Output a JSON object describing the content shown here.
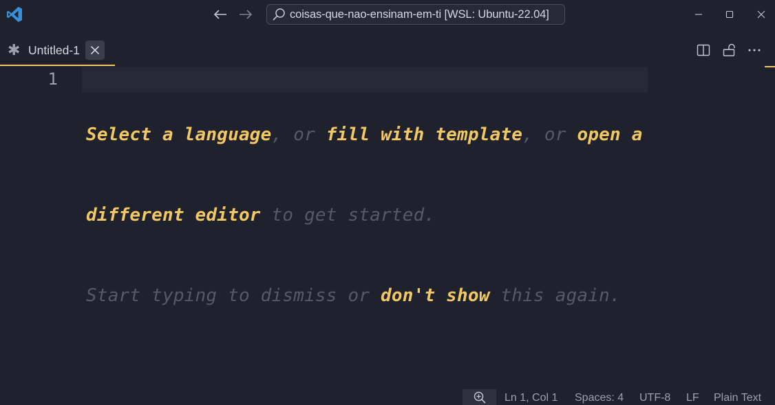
{
  "titlebar": {
    "logo_icon": "vscode-logo-icon",
    "back_icon": "arrow-left-icon",
    "forward_icon": "arrow-right-icon",
    "command_center_text": "coisas-que-nao-ensinam-em-ti [WSL: Ubuntu-22.04]",
    "window_controls": [
      "minimize-icon",
      "maximize-icon",
      "close-icon"
    ]
  },
  "tabs": [
    {
      "label": "Untitled-1",
      "dirty": true,
      "active": true
    }
  ],
  "tab_actions": [
    "split-editor-icon",
    "lock-icon",
    "more-actions-icon"
  ],
  "editor": {
    "line_numbers": [
      "1"
    ],
    "hint": {
      "select_language": "Select a language",
      "sep1": ", or ",
      "fill_template": "fill with template",
      "sep2": ", or ",
      "open_editor_1": "open a",
      "open_editor_2": "different editor",
      "get_started": " to get started.",
      "start_typing": "Start typing to dismiss or ",
      "dont_show": "don't show",
      "this_again": " this again."
    }
  },
  "statusbar": {
    "zoom_icon": "zoom-in-icon",
    "position": "Ln 1, Col 1",
    "spaces": "Spaces: 4",
    "encoding": "UTF-8",
    "eol": "LF",
    "language": "Plain Text"
  },
  "colors": {
    "background": "#1f222d",
    "accent": "#f2c865",
    "hint_text": "#545a68",
    "text": "#d5d8e0"
  }
}
